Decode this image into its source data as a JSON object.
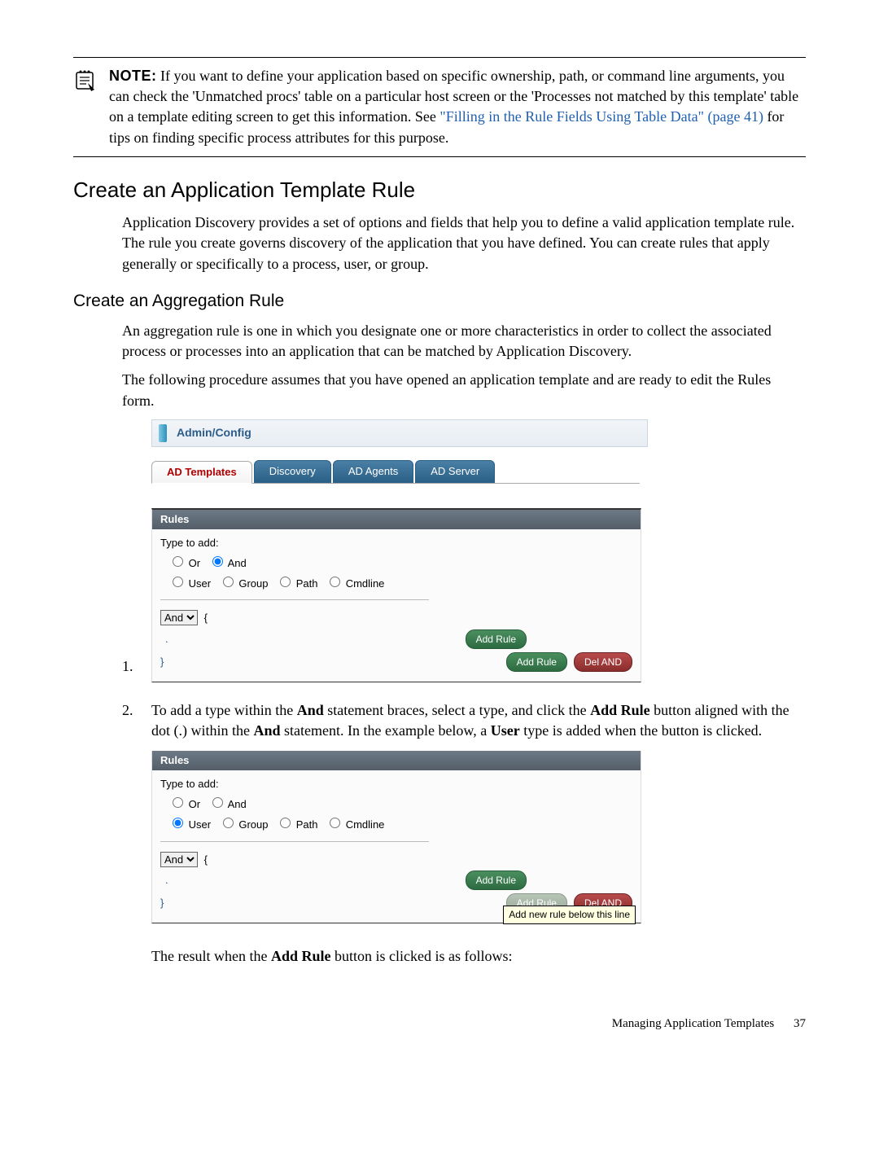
{
  "note": {
    "label": "NOTE:",
    "text1": "If you want to define your application based on specific ownership, path, or command line arguments, you can check the 'Unmatched procs' table on a particular host screen or the 'Processes not matched by this template' table on a template editing screen to get this information. See",
    "link": "\"Filling in the Rule Fields Using Table Data\" (page 41)",
    "text2": " for tips on finding specific process attributes for this purpose."
  },
  "section": {
    "title": "Create an Application Template Rule",
    "para": "Application Discovery provides a set of options and fields that help you to define a valid application template rule. The rule you create governs discovery of the application that you have defined. You can create rules that apply generally or specifically to a process, user, or group."
  },
  "subsection": {
    "title": "Create an Aggregation Rule",
    "para1": "An aggregation rule is one in which you designate one or more characteristics in order to collect the associated process or processes into an application that can be matched by Application Discovery.",
    "para2": "The following procedure assumes that you have opened an application template and are ready to edit the Rules form."
  },
  "admin_config": {
    "title": "Admin/Config",
    "tabs": {
      "templates": "AD Templates",
      "discovery": "Discovery",
      "agents": "AD Agents",
      "server": "AD Server"
    }
  },
  "rules": {
    "header": "Rules",
    "type_to_add": "Type to add:",
    "or": "Or",
    "and_label": "And",
    "user": "User",
    "group": "Group",
    "path": "Path",
    "cmdline": "Cmdline",
    "and_select": "And",
    "brace_open": "{",
    "dot": ".",
    "brace_close": "}",
    "add_rule": "Add Rule",
    "del_and": "Del AND",
    "tooltip": "Add new rule below this line"
  },
  "step2": {
    "text_a": "To add a type within the ",
    "and_b": "And",
    "text_b": " statement braces, select a type, and click the ",
    "addrule_b": "Add Rule",
    "text_c": " button aligned with the dot (.) within the ",
    "and_b2": "And",
    "text_d": "  statement. In the example below, a ",
    "user_b": "User",
    "text_e": " type is added when the button is clicked."
  },
  "result_line": {
    "a": "The result when the ",
    "b": "Add Rule",
    "c": " button is clicked is as follows:"
  },
  "footer": {
    "title": "Managing Application Templates",
    "page": "37"
  }
}
